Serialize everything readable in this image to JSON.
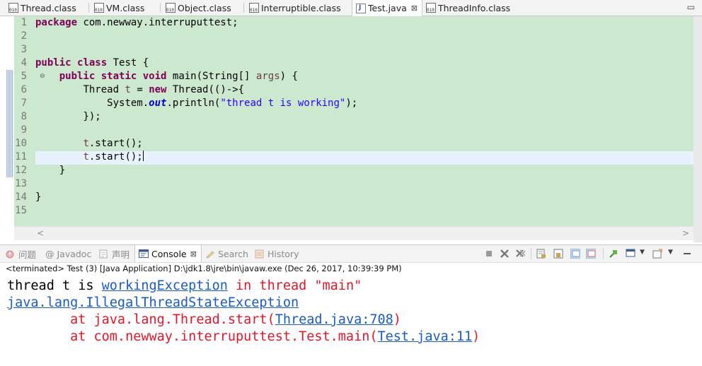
{
  "editor_tabs": [
    {
      "label": "Thread.class",
      "icon": "class-file-icon"
    },
    {
      "label": "VM.class",
      "icon": "class-file-icon"
    },
    {
      "label": "Object.class",
      "icon": "class-file-icon"
    },
    {
      "label": "Interruptible.class",
      "icon": "class-file-icon"
    },
    {
      "label": "Test.java",
      "icon": "java-file-icon",
      "active": true,
      "close": "⊠"
    },
    {
      "label": "ThreadInfo.class",
      "icon": "class-file-icon"
    }
  ],
  "editor": {
    "line_numbers": [
      "1",
      "2",
      "3",
      "4",
      "5",
      "6",
      "7",
      "8",
      "9",
      "10",
      "11",
      "12",
      "13",
      "14",
      "15"
    ],
    "code": {
      "l1_kw": "package",
      "l1_rest": " com.newway.interruputtest;",
      "l4_kw1": "public",
      "l4_kw2": "class",
      "l4_rest": " Test {",
      "l5_kw1": "public",
      "l5_kw2": "static",
      "l5_kw3": "void",
      "l5_rest": " main(String[] ",
      "l5_arg": "args",
      "l5_end": ") {",
      "l6_type": "Thread ",
      "l6_var": "t",
      "l6_eq": " = ",
      "l6_kw": "new",
      "l6_rest": " Thread(()->{",
      "l7_a": "System.",
      "l7_fld": "out",
      "l7_b": ".println(",
      "l7_str": "\"thread t is working\"",
      "l7_c": ");",
      "l8": "});",
      "l10_var": "t",
      "l10_rest": ".start();",
      "l11_var": "t",
      "l11_rest": ".start();",
      "l12": "}",
      "l14": "}"
    },
    "scroll_left": "<",
    "scroll_right": ">"
  },
  "views": {
    "tabs": [
      {
        "label": "问题",
        "icon": "problems-icon"
      },
      {
        "label": "@ Javadoc",
        "icon": "javadoc-icon"
      },
      {
        "label": "声明",
        "icon": "declaration-icon"
      },
      {
        "label": "Console",
        "icon": "console-icon",
        "active": true,
        "close": "⊠"
      },
      {
        "label": "Search",
        "icon": "search-icon"
      },
      {
        "label": "History",
        "icon": "history-icon"
      }
    ]
  },
  "console": {
    "status": "<terminated> Test (3) [Java Application] D:\\jdk1.8\\jre\\bin\\javaw.exe (Dec 26, 2017, 10:39:39 PM)",
    "line1_out": "thread t is ",
    "line1_link": "workingException",
    "line1_err": " in thread \"main\"",
    "line2_link": "java.lang.IllegalThreadStateException",
    "line3_at": "at java.lang.Thread.start(",
    "line3_link": "Thread.java:708",
    "line3_end": ")",
    "line4_at": "at com.newway.interruputtest.Test.main(",
    "line4_link": "Test.java:11",
    "line4_end": ")"
  },
  "colors": {
    "code_background": "#cce8cf",
    "keyword": "#7f0055",
    "string": "#2a00ff",
    "error": "#e2162b",
    "link": "#1a5bc0"
  }
}
